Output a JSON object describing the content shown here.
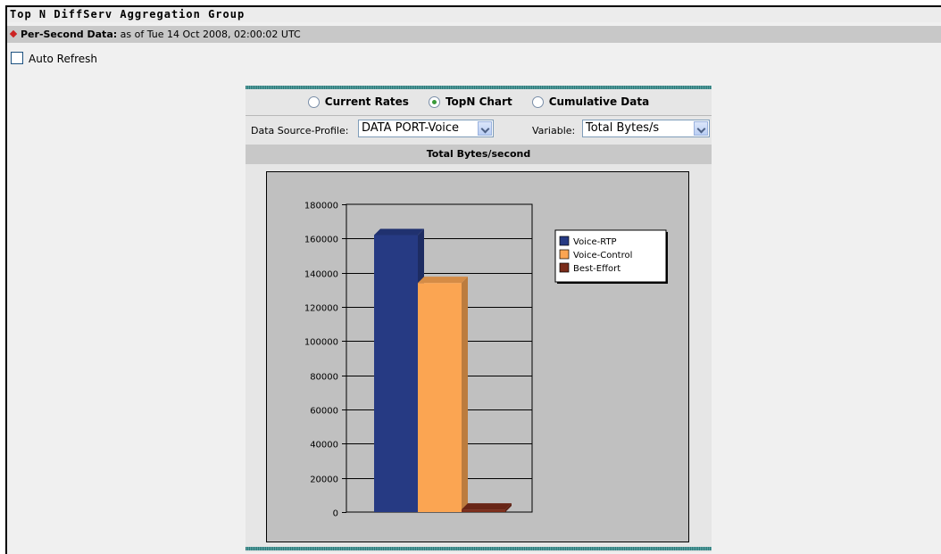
{
  "page": {
    "title": "Top N DiffServ Aggregation Group",
    "subtitle_label": "Per-Second Data:",
    "subtitle_value": "as of Tue 14 Oct 2008, 02:00:02 UTC",
    "auto_refresh_label": "Auto Refresh"
  },
  "view_options": {
    "current_rates": "Current Rates",
    "topn_chart": "TopN Chart",
    "cumulative_data": "Cumulative Data",
    "selected": "topn_chart"
  },
  "selectors": {
    "data_source_label": "Data Source-Profile:",
    "data_source_value": "DATA PORT-Voice",
    "variable_label": "Variable:",
    "variable_value": "Total Bytes/s"
  },
  "chart_header": "Total Bytes/second",
  "chart_data": {
    "type": "bar",
    "categories": [
      "Voice-RTP",
      "Voice-Control",
      "Best-Effort"
    ],
    "values": [
      162000,
      134000,
      1500
    ],
    "colors": [
      "#263a83",
      "#fba552",
      "#7a2c1a"
    ],
    "ylim": [
      0,
      180000
    ],
    "yticks": [
      0,
      20000,
      40000,
      60000,
      80000,
      100000,
      120000,
      140000,
      160000,
      180000
    ],
    "legend": [
      "Voice-RTP",
      "Voice-Control",
      "Best-Effort"
    ],
    "legend_position": "right",
    "grid": true
  }
}
